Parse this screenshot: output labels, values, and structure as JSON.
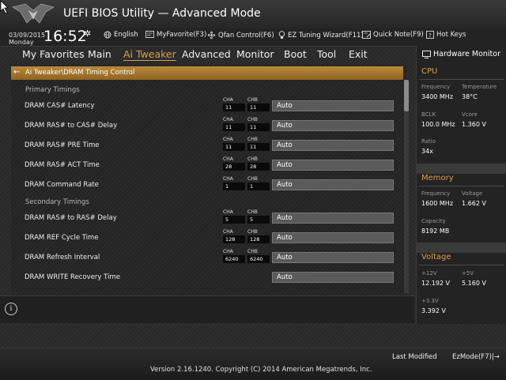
{
  "header": {
    "title": "UEFI BIOS Utility — Advanced Mode",
    "date": "03/09/2015",
    "day": "Monday",
    "time": "16:52"
  },
  "toolbar": {
    "language": "English",
    "myfavorite": "MyFavorite(F3)",
    "qfan": "Qfan Control(F6)",
    "ez_tuning": "EZ Tuning Wizard(F11)",
    "quick_note": "Quick Note(F9)",
    "hot_keys": "Hot Keys"
  },
  "nav": {
    "tabs": [
      "My Favorites",
      "Main",
      "Ai Tweaker",
      "Advanced",
      "Monitor",
      "Boot",
      "Tool",
      "Exit"
    ],
    "active": "Ai Tweaker"
  },
  "breadcrumb": "Ai Tweaker\\DRAM Timing Control",
  "sections": {
    "primary": "Primary Timings",
    "secondary": "Secondary Timings"
  },
  "channel_labels": {
    "a": "CHA",
    "b": "CHB"
  },
  "rows": [
    {
      "label": "DRAM CAS# Latency",
      "cha": "11",
      "chb": "11",
      "value": "Auto"
    },
    {
      "label": "DRAM RAS# to CAS# Delay",
      "cha": "11",
      "chb": "11",
      "value": "Auto"
    },
    {
      "label": "DRAM RAS# PRE Time",
      "cha": "11",
      "chb": "11",
      "value": "Auto"
    },
    {
      "label": "DRAM RAS# ACT Time",
      "cha": "28",
      "chb": "28",
      "value": "Auto"
    },
    {
      "label": "DRAM Command Rate",
      "cha": "1",
      "chb": "1",
      "value": "Auto"
    },
    {
      "label": "DRAM RAS# to RAS# Delay",
      "cha": "5",
      "chb": "5",
      "value": "Auto"
    },
    {
      "label": "DRAM REF Cycle Time",
      "cha": "128",
      "chb": "128",
      "value": "Auto"
    },
    {
      "label": "DRAM Refresh Interval",
      "cha": "6240",
      "chb": "6240",
      "value": "Auto"
    },
    {
      "label": "DRAM WRITE Recovery Time",
      "cha": "",
      "chb": "",
      "value": "Auto"
    }
  ],
  "hardware_monitor": {
    "title": "Hardware Monitor",
    "cpu": {
      "heading": "CPU",
      "frequency_label": "Frequency",
      "frequency": "3400 MHz",
      "temperature_label": "Temperature",
      "temperature": "38°C",
      "bclk_label": "BCLK",
      "bclk": "100.0 MHz",
      "vcore_label": "Vcore",
      "vcore": "1.360 V",
      "ratio_label": "Ratio",
      "ratio": "34x"
    },
    "memory": {
      "heading": "Memory",
      "frequency_label": "Frequency",
      "frequency": "1600 MHz",
      "voltage_label": "Voltage",
      "voltage": "1.662 V",
      "capacity_label": "Capacity",
      "capacity": "8192 MB"
    },
    "voltage": {
      "heading": "Voltage",
      "v12_label": "+12V",
      "v12": "12.192 V",
      "v5_label": "+5V",
      "v5": "5.160 V",
      "v33_label": "+3.3V",
      "v33": "3.392 V"
    }
  },
  "footer": {
    "last_modified": "Last Modified",
    "ezmode": "EzMode(F7)|→",
    "copyright": "Version 2.16.1240. Copyright (C) 2014 American Megatrends, Inc."
  },
  "colors": {
    "accent": "#d7a24a",
    "breadcrumb_bar": "#a9792f",
    "select_bg": "#5a5a5a"
  }
}
